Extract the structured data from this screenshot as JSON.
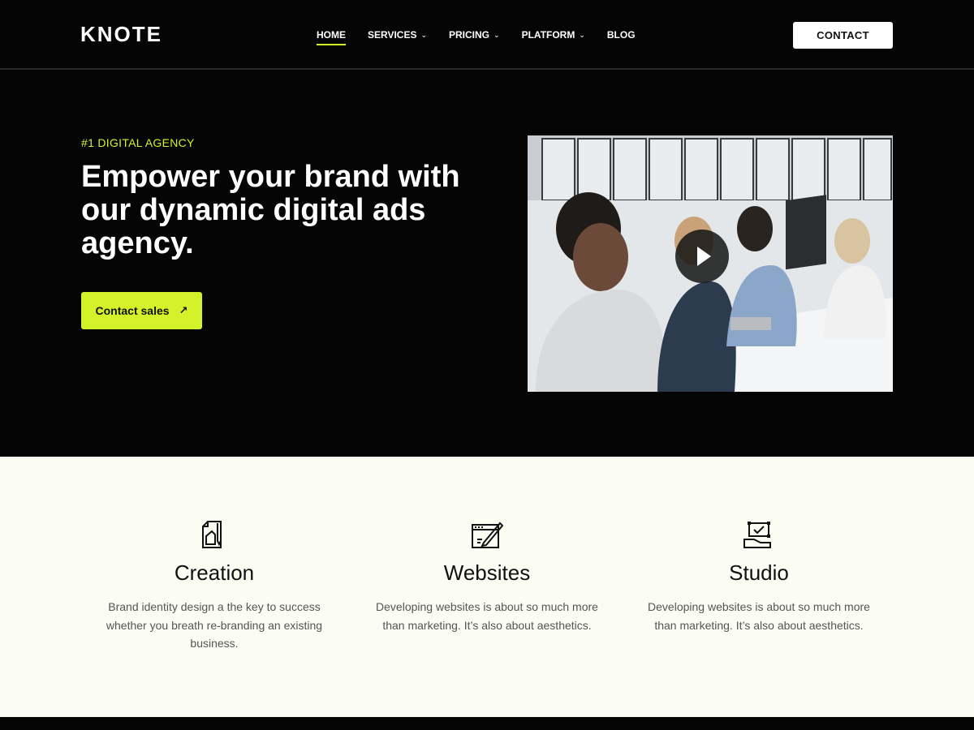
{
  "header": {
    "logo": "KNOTE",
    "nav": [
      {
        "label": "HOME",
        "has_dropdown": false,
        "active": true
      },
      {
        "label": "SERVICES",
        "has_dropdown": true,
        "active": false
      },
      {
        "label": "PRICING",
        "has_dropdown": true,
        "active": false
      },
      {
        "label": "PLATFORM",
        "has_dropdown": true,
        "active": false
      },
      {
        "label": "BLOG",
        "has_dropdown": false,
        "active": false
      }
    ],
    "contact_label": "CONTACT"
  },
  "hero": {
    "eyebrow": "#1 DIGITAL AGENCY",
    "title": "Empower your brand with our dynamic digital ads agency.",
    "cta_label": "Contact sales",
    "cta_icon": "arrow-up-right-icon",
    "media_icon": "play-icon"
  },
  "features": [
    {
      "icon": "document-pen-icon",
      "title": "Creation",
      "text": "Brand identity design a the key to success whether you breath re-branding an existing business."
    },
    {
      "icon": "browser-pencil-icon",
      "title": "Websites",
      "text": "Developing websites is about so much more than marketing. It’s also about aesthetics."
    },
    {
      "icon": "hand-box-icon",
      "title": "Studio",
      "text": "Developing websites is about so much more than marketing. It’s also about aesthetics."
    }
  ],
  "colors": {
    "accent": "#d4f22a",
    "background": "#050505",
    "feature_bg": "#fbfdf3"
  }
}
